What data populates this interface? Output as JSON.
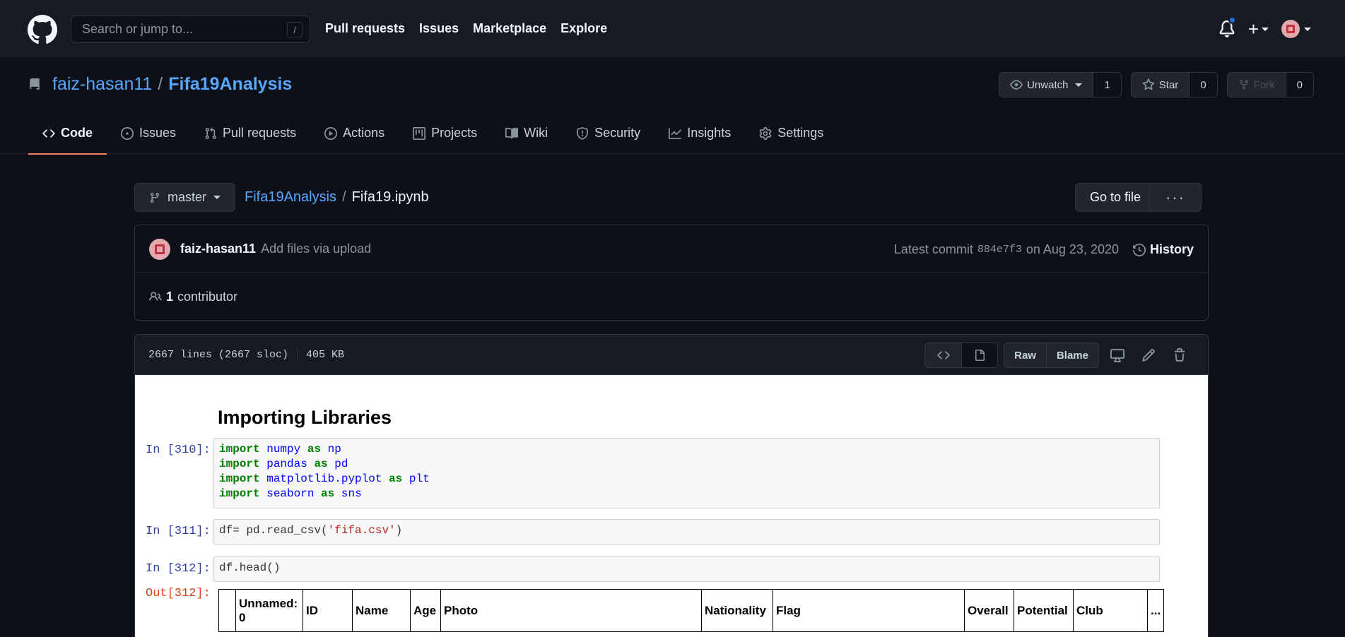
{
  "header": {
    "search_placeholder": "Search or jump to...",
    "search_shortcut": "/",
    "nav": [
      "Pull requests",
      "Issues",
      "Marketplace",
      "Explore"
    ],
    "plus": "+"
  },
  "repo": {
    "owner": "faiz-hasan11",
    "separator": "/",
    "name": "Fifa19Analysis",
    "watch": {
      "label": "Unwatch",
      "count": "1"
    },
    "star": {
      "label": "Star",
      "count": "0"
    },
    "fork": {
      "label": "Fork",
      "count": "0"
    },
    "tabs": [
      "Code",
      "Issues",
      "Pull requests",
      "Actions",
      "Projects",
      "Wiki",
      "Security",
      "Insights",
      "Settings"
    ]
  },
  "filenav": {
    "branch": "master",
    "repo": "Fifa19Analysis",
    "sep": "/",
    "file": "Fifa19.ipynb",
    "goto": "Go to file",
    "more": "···"
  },
  "commit": {
    "author": "faiz-hasan11",
    "message": "Add files via upload",
    "latest_label": "Latest commit",
    "sha": "884e7f3",
    "date": "on Aug 23, 2020",
    "history": "History",
    "contributors_count": "1",
    "contributors_label": "contributor"
  },
  "file": {
    "lines": "2667 lines (2667 sloc)",
    "size": "405 KB",
    "raw": "Raw",
    "blame": "Blame"
  },
  "notebook": {
    "heading": "Importing Libraries",
    "cells": [
      {
        "prompt": "In [310]:"
      },
      {
        "prompt": "In [311]:",
        "code": "df= pd.read_csv(",
        "str": "'fifa.csv'",
        "end": ")"
      },
      {
        "prompt": "In [312]:",
        "code": "df.head()"
      },
      {
        "prompt": "Out[312]:"
      }
    ],
    "imports": [
      {
        "kw": "import",
        "mod": "numpy",
        "as": "as",
        "alias": "np"
      },
      {
        "kw": "import",
        "mod": "pandas",
        "as": "as",
        "alias": "pd"
      },
      {
        "kw": "import",
        "mod": "matplotlib.pyplot",
        "as": "as",
        "alias": "plt"
      },
      {
        "kw": "import",
        "mod": "seaborn",
        "as": "as",
        "alias": "sns"
      }
    ],
    "table_headers": [
      "",
      "Unnamed: 0",
      "ID",
      "Name",
      "Age",
      "Photo",
      "Nationality",
      "Flag",
      "Overall",
      "Potential",
      "Club",
      "..."
    ]
  }
}
